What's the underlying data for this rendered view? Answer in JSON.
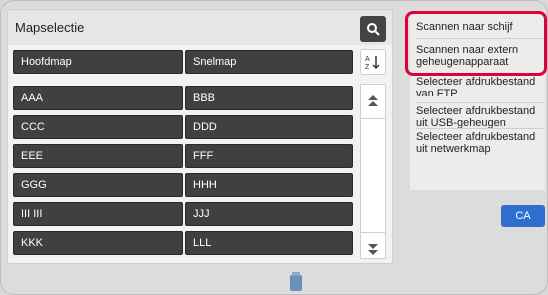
{
  "header": {
    "title": "Mapselectie"
  },
  "tabs": {
    "left": "Hoofdmap",
    "right": "Snelmap"
  },
  "folders": [
    [
      "AAA",
      "BBB"
    ],
    [
      "CCC",
      "DDD"
    ],
    [
      "EEE",
      "FFF"
    ],
    [
      "GGG",
      "HHH"
    ],
    [
      "III III",
      "JJJ"
    ],
    [
      "KKK",
      "LLL"
    ]
  ],
  "menu": {
    "items": [
      "Scannen naar schijf",
      "Scannen naar extern geheugenapparaat",
      "Selecteer afdrukbestand van FTP",
      "Selecteer afdrukbestand uit USB-geheugen",
      "Selecteer afdrukbestand uit netwerkmap"
    ]
  },
  "ca_label": "CA",
  "colors": {
    "highlight": "#e0003a",
    "ca_button": "#2f6fd0",
    "folder_button": "#404040"
  },
  "icons": [
    "search-icon",
    "sort-icon",
    "scroll-up-icon",
    "scroll-down-icon",
    "usb-icon"
  ]
}
